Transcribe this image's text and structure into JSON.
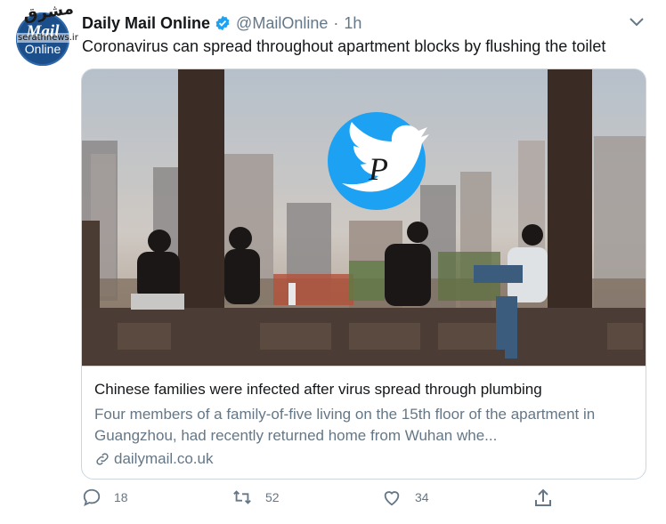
{
  "watermark": {
    "logo": "مشرق",
    "site": "serathnews.ir"
  },
  "avatar": {
    "line1": "Mail",
    "line2": "Online"
  },
  "header": {
    "name": "Daily Mail Online",
    "handle": "@MailOnline",
    "separator": "·",
    "time": "1h"
  },
  "tweet": {
    "text": "Coronavirus can spread throughout apartment blocks by flushing the toilet"
  },
  "card": {
    "title": "Chinese families were infected after virus spread through plumbing",
    "description": "Four members of a family-of-five living on the 15th floor of the apartment in Guangzhou, had recently returned home from Wuhan whe...",
    "domain": "dailymail.co.uk"
  },
  "actions": {
    "replies": "18",
    "retweets": "52",
    "likes": "34"
  },
  "colors": {
    "text": "#14171a",
    "secondary": "#657786",
    "twitter_blue": "#1da1f2",
    "border": "#ccd6dd"
  }
}
